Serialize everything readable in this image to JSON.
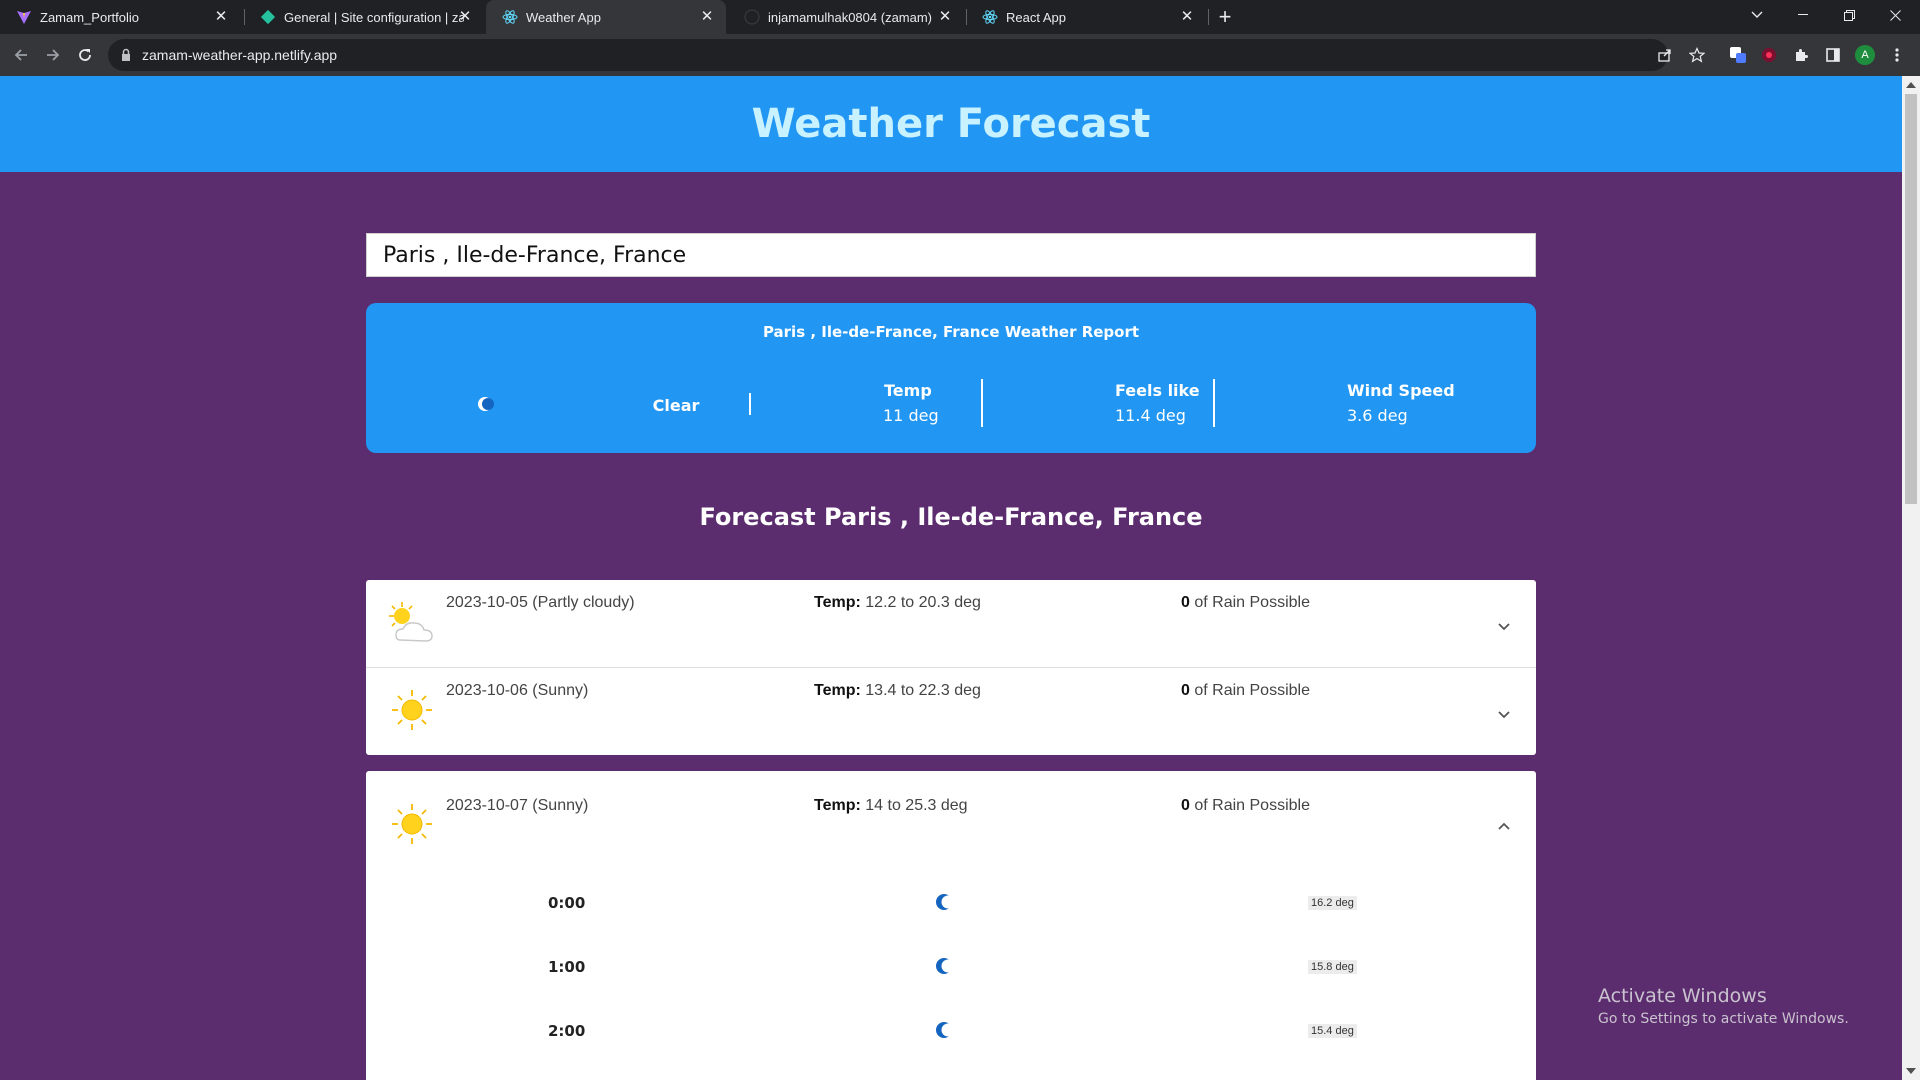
{
  "browser": {
    "tabs": [
      {
        "title": "Zamam_Portfolio",
        "icon": "vite-icon"
      },
      {
        "title": "General | Site configuration | zam",
        "icon": "netlify-icon"
      },
      {
        "title": "Weather App",
        "icon": "react-icon",
        "active": true
      },
      {
        "title": "injamamulhak0804 (zamam)",
        "icon": "github-icon"
      },
      {
        "title": "React App",
        "icon": "react-icon"
      }
    ],
    "url": "zamam-weather-app.netlify.app",
    "profile_initial": "A"
  },
  "app": {
    "header_title": "Weather Forecast",
    "search_value": "Paris , Ile-de-France, France",
    "current": {
      "title": "Paris , Ile-de-France, France Weather Report",
      "condition": "Clear",
      "temp_label": "Temp",
      "temp_value": "11 deg",
      "feels_label": "Feels like",
      "feels_value": "11.4 deg",
      "wind_label": "Wind Speed",
      "wind_value": "3.6 deg"
    },
    "forecast_title": "Forecast Paris , Ile-de-France, France",
    "days": [
      {
        "date": "2023-10-05 (Partly cloudy)",
        "temp_label": "Temp:",
        "temp": "12.2 to 20.3 deg",
        "rain_count": "0",
        "rain_text": "of Rain Possible",
        "icon": "partly-cloudy-icon"
      },
      {
        "date": "2023-10-06 (Sunny)",
        "temp_label": "Temp:",
        "temp": "13.4 to 22.3 deg",
        "rain_count": "0",
        "rain_text": "of Rain Possible",
        "icon": "sun-icon"
      },
      {
        "date": "2023-10-07 (Sunny)",
        "temp_label": "Temp:",
        "temp": "14 to 25.3 deg",
        "rain_count": "0",
        "rain_text": "of Rain Possible",
        "icon": "sun-icon",
        "hours": [
          {
            "time": "0:00",
            "temp": "16.2 deg"
          },
          {
            "time": "1:00",
            "temp": "15.8 deg"
          },
          {
            "time": "2:00",
            "temp": "15.4 deg"
          }
        ]
      }
    ]
  },
  "os": {
    "activate_title": "Activate Windows",
    "activate_sub": "Go to Settings to activate Windows."
  },
  "colors": {
    "header_blue": "#2196f3",
    "page_purple": "#5c2d6e",
    "title_cyan": "#c8f2ff"
  }
}
